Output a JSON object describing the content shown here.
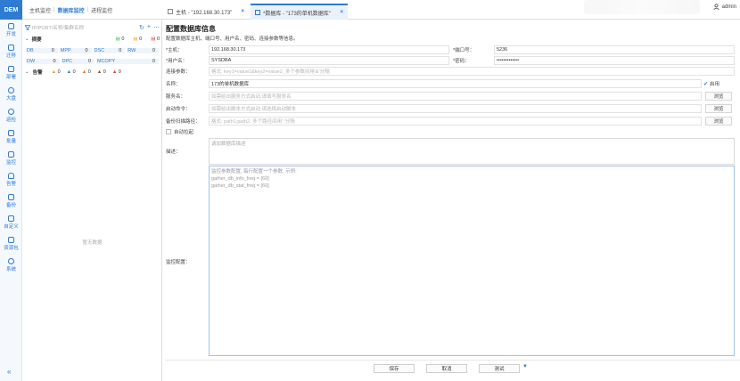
{
  "app": {
    "logo": "DEM",
    "user": "admin"
  },
  "nav": {
    "host_monitor": "主机监控",
    "db_monitor": "数据库监控",
    "proc_monitor": "进程监控"
  },
  "tabs": [
    {
      "label": "主机 - \"192.168.30.173\"",
      "close": "×"
    },
    {
      "label": "*数据库 - \"173的单机数据库\"",
      "close": "×"
    }
  ],
  "sidebar": {
    "items": [
      {
        "label": "开发",
        "icon": "grid-icon"
      },
      {
        "label": "迁移",
        "icon": "link-icon"
      },
      {
        "label": "部署",
        "icon": "deploy-icon"
      },
      {
        "label": "大盘",
        "icon": "dashboard-icon"
      },
      {
        "label": "巡检",
        "icon": "inspect-icon"
      },
      {
        "label": "批量",
        "icon": "batch-icon"
      },
      {
        "label": "监控",
        "icon": "monitor-icon"
      },
      {
        "label": "告警",
        "icon": "bell-icon"
      },
      {
        "label": "备份",
        "icon": "backup-icon"
      },
      {
        "label": "自定义",
        "icon": "custom-icon"
      },
      {
        "label": "资源包",
        "icon": "package-icon"
      },
      {
        "label": "系统",
        "icon": "gear-icon"
      }
    ],
    "collapse": "«"
  },
  "tree": {
    "search_placeholder": "IP/PORT/名称/集群名称",
    "summary_label": "摘要",
    "summary_counts": [
      "0",
      "0",
      "0"
    ],
    "stats": [
      [
        {
          "k": "DB",
          "v": "0"
        },
        {
          "k": "MPP",
          "v": "0"
        },
        {
          "k": "DSC",
          "v": "0"
        },
        {
          "k": "RW",
          "v": "0"
        }
      ],
      [
        {
          "k": "DW",
          "v": "0"
        },
        {
          "k": "DPC",
          "v": "0"
        },
        {
          "k": "MCOPY",
          "v": "0"
        }
      ]
    ],
    "warn_label": "告警",
    "warn_counts": [
      "0",
      "0",
      "0",
      "0",
      "0"
    ],
    "no_data": "暂无数据"
  },
  "form": {
    "title": "配置数据库信息",
    "subtitle": "配置数据库主机、端口号、用户名、密码、连接参数等信息。",
    "host_label": "*主机：",
    "host_value": "192.168.30.173",
    "port_label": "*端口号：",
    "port_value": "5236",
    "user_label": "*用户名：",
    "user_value": "SYSDBA",
    "pwd_label": "*密码：",
    "pwd_value": "•••••••••••••",
    "conn_label": "连接参数：",
    "conn_placeholder": "格式: key1=value1&key2=value2, 多个参数间用'&'分隔",
    "name_label": "名称：",
    "name_value": "173的单机数据库",
    "enable_label": "启用",
    "service_label": "服务名：",
    "service_placeholder": "如需给出服务方式启动,请填写服务名",
    "start_label": "启动命令：",
    "start_placeholder": "如需给出脚本方式启动,请选择启动脚本",
    "backup_label": "备份扫描路径：",
    "backup_placeholder": "格式: path1;path2, 多个路径间用';'分隔",
    "browse": "浏览",
    "autostart_label": "自动拉起",
    "desc_label": "描述：",
    "desc_placeholder": "请加数据库描述",
    "monitor_label": "监控配置：",
    "monitor_lines": [
      "监控参数配置, 每行配置一个参数, 示例:",
      "gather_db_info_freq = [60]",
      "gather_db_stat_freq = [60]"
    ]
  },
  "buttons": {
    "save": "保存",
    "cancel": "取消",
    "test": "测试"
  }
}
